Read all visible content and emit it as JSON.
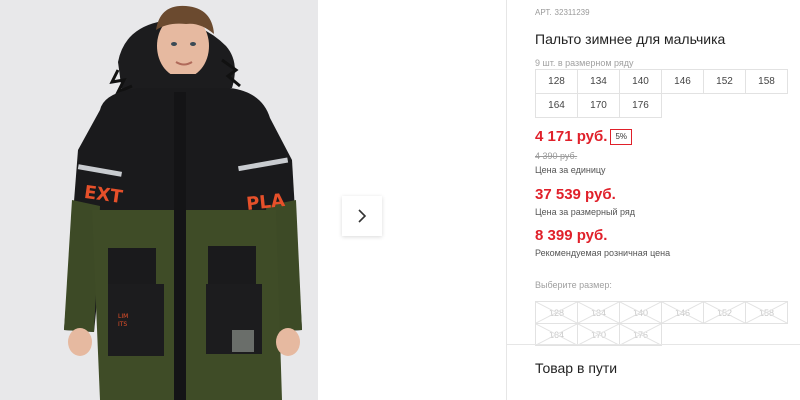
{
  "product": {
    "article_label": "АРТ.",
    "article_number": "32311239",
    "title": "Пальто зимнее для мальчика",
    "row_count_text": "9 шт. в размерном ряду",
    "sizes_in_row": [
      "128",
      "134",
      "140",
      "146",
      "152",
      "158",
      "164",
      "170",
      "176"
    ]
  },
  "pricing": {
    "unit_price": "4 171 руб.",
    "discount_badge": "5%",
    "old_price": "4 390 руб.",
    "unit_price_note": "Цена за единицу",
    "row_price": "37 539 руб.",
    "row_price_note": "Цена за размерный ряд",
    "retail_price": "8 399 руб.",
    "retail_price_note": "Рекомендуемая розничная цена"
  },
  "size_picker": {
    "label": "Выберите размер:",
    "options": [
      "128",
      "134",
      "140",
      "146",
      "152",
      "158",
      "164",
      "170",
      "176"
    ],
    "state": "unavailable"
  },
  "availability": {
    "status": "Товар в пути"
  },
  "gallery": {
    "next_icon": "chevron-right-icon",
    "photo_print_text": "NEXT PLAY",
    "photo_badge_text": "LIMITS"
  },
  "colors": {
    "price_accent": "#e0202a",
    "muted_text": "#9a9a9a",
    "border": "#e2e2e2"
  }
}
